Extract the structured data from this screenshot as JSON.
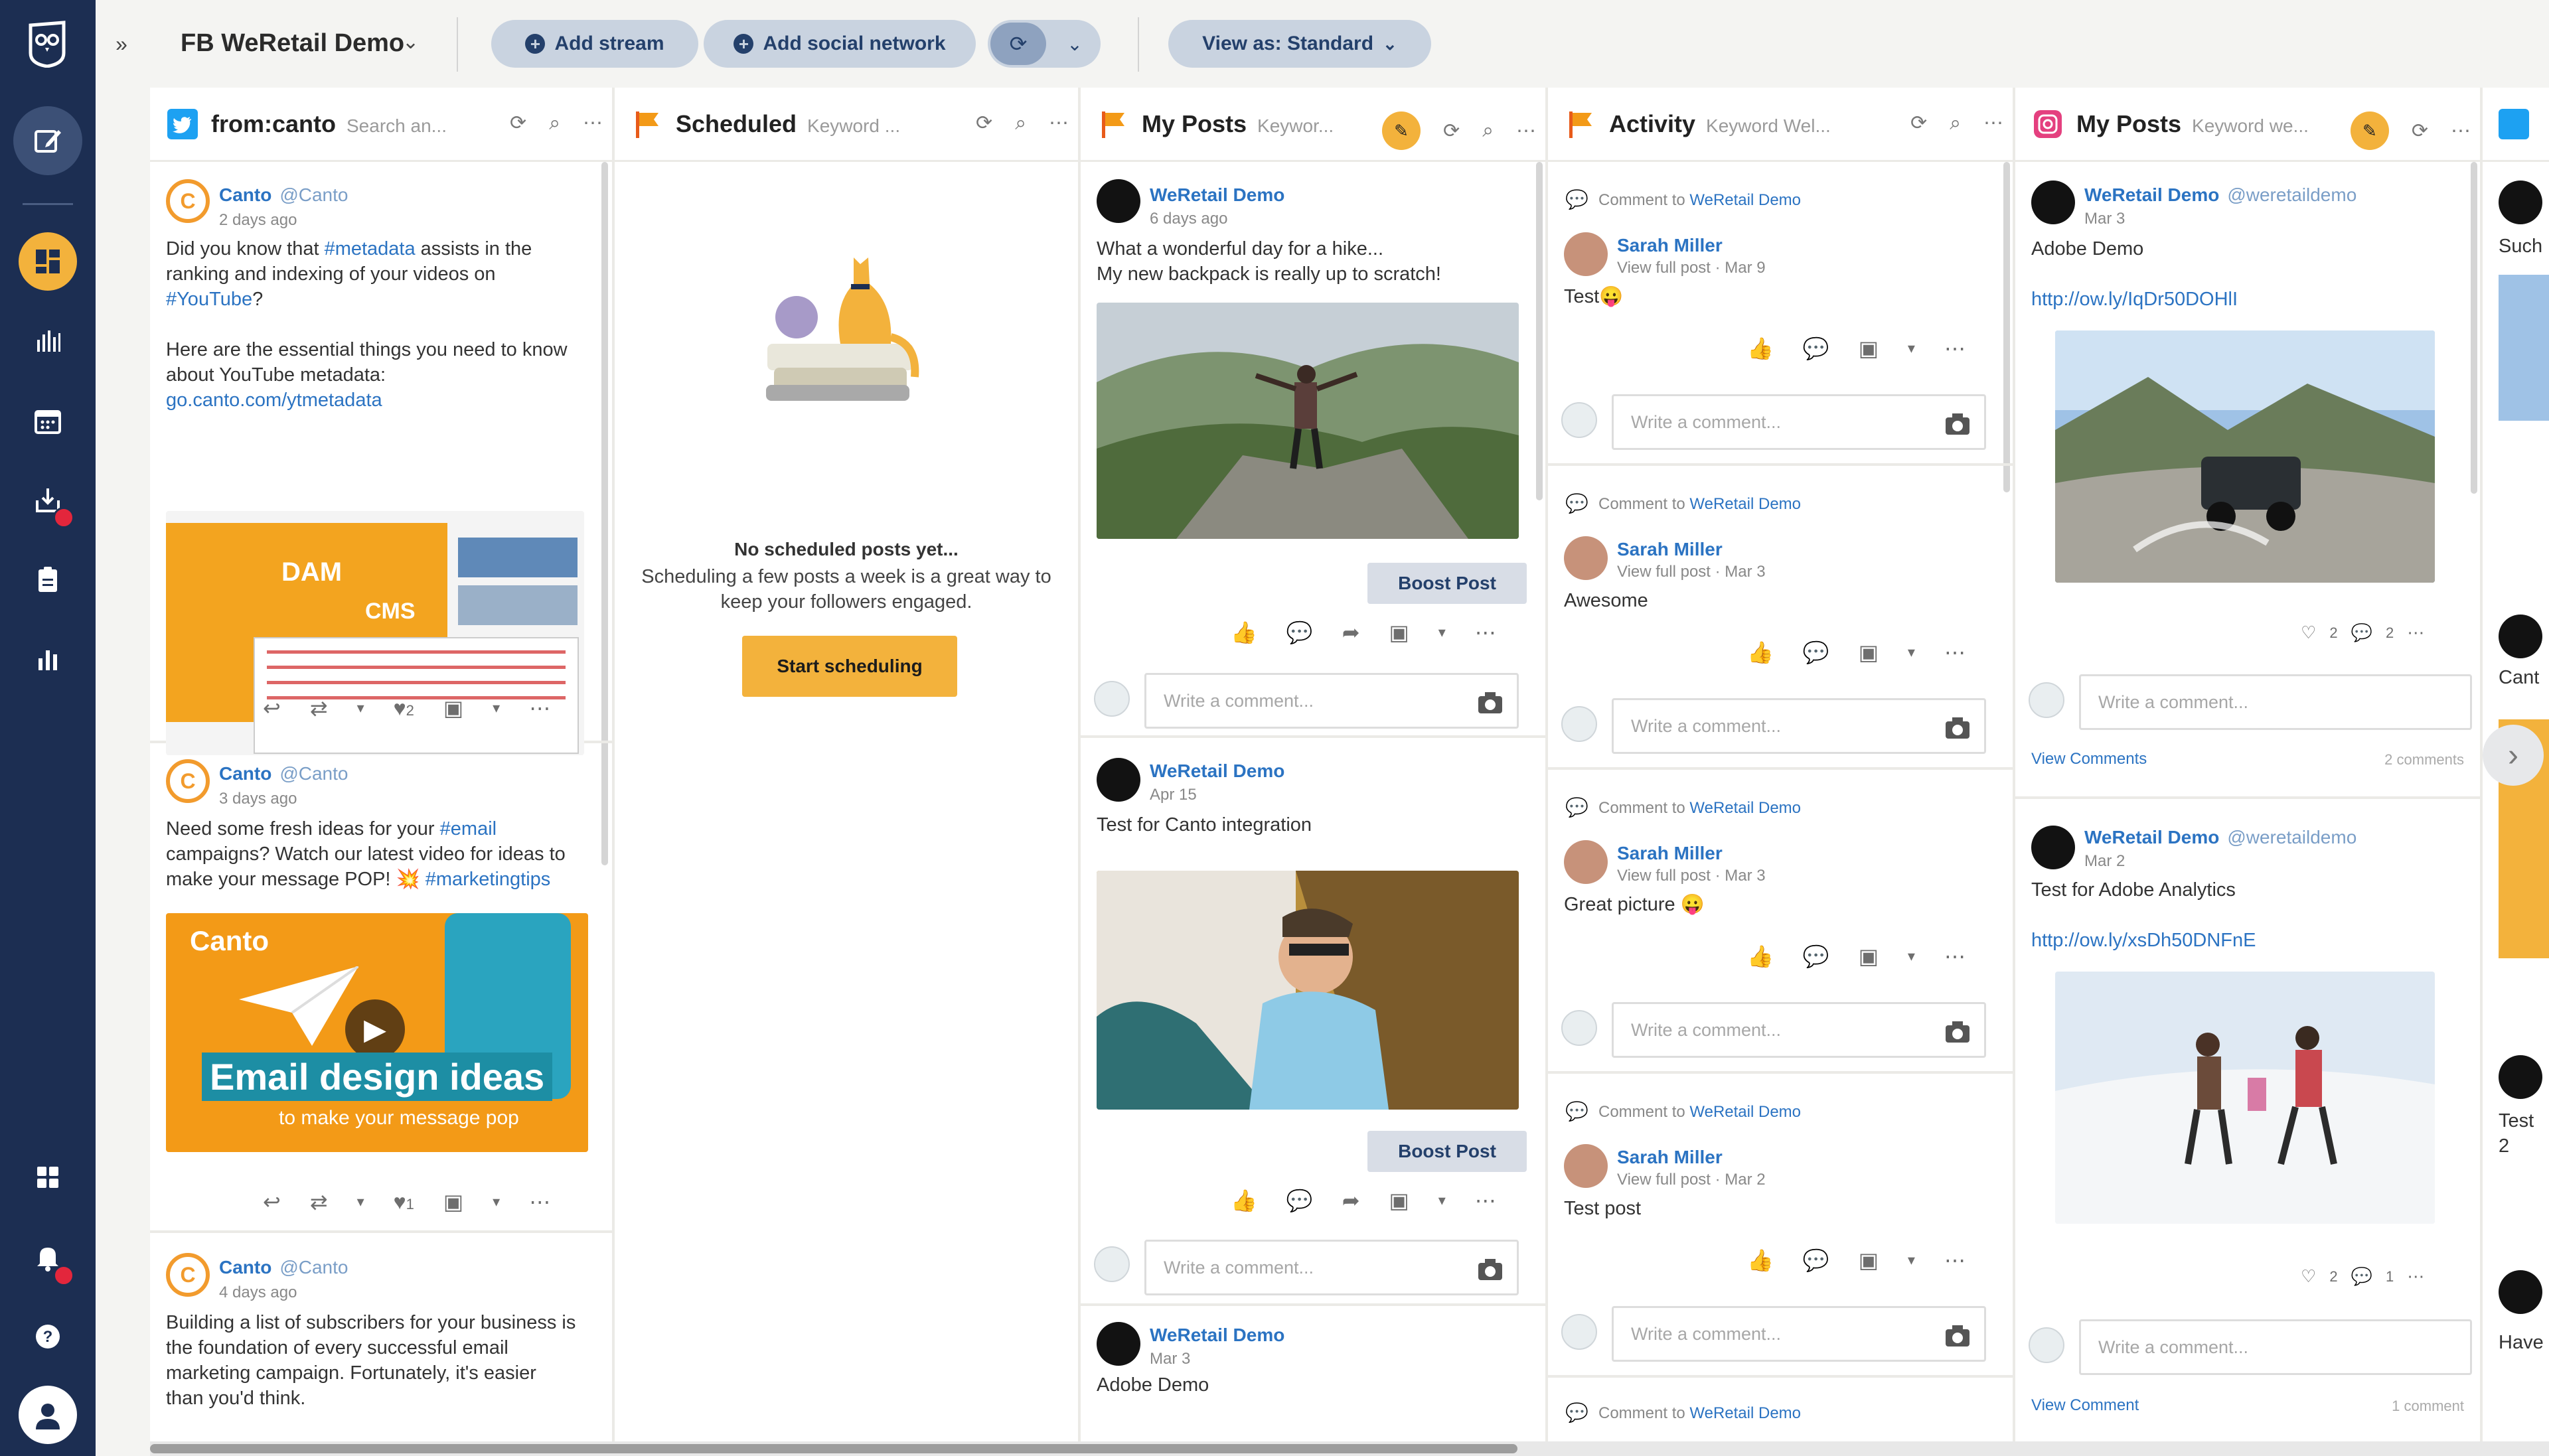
{
  "topbar": {
    "title": "FB WeRetail Demo",
    "add_stream": "Add stream",
    "add_social_network": "Add social network",
    "view_as": "View as: Standard"
  },
  "colors": {
    "nav": "#1c2e52",
    "accent": "#f3b23c",
    "link": "#2b73c2",
    "twitter": "#1da1f2",
    "instagram": "#e4407f"
  },
  "streams": {
    "s1": {
      "title": "from:canto",
      "subtitle": "Search an...",
      "posts": [
        {
          "name": "Canto",
          "handle": "@Canto",
          "time": "2 days ago",
          "text1_a": "Did you know that ",
          "text1_tag": "#metadata",
          "text1_b": " assists in the ranking and indexing of your videos on ",
          "text1_tag2": "#YouTube",
          "text1_c": "?",
          "text2": "Here are the essential things you need to know about YouTube metadata:",
          "link": "go.canto.com/ytmetadata",
          "img_label1": "DAM",
          "img_label2": "CMS",
          "likes": "2"
        },
        {
          "name": "Canto",
          "handle": "@Canto",
          "time": "3 days ago",
          "text_a": "Need some fresh ideas for your ",
          "text_tag": "#email",
          "text_b": " campaigns? Watch our latest video for ideas to make your message POP! 💥 ",
          "text_tag2": "#marketingtips",
          "img_brand": "Canto",
          "img_title": "Email design ideas",
          "img_sub": "to make your message pop",
          "likes": "1"
        },
        {
          "name": "Canto",
          "handle": "@Canto",
          "time": "4 days ago",
          "text": "Building a list of subscribers for your business is the foundation of every successful email marketing campaign. Fortunately, it's easier than you'd think."
        }
      ]
    },
    "s2": {
      "title": "Scheduled",
      "subtitle": "Keyword ...",
      "empty_title": "No scheduled posts yet...",
      "empty_sub": "Scheduling a few posts a week is a great way to keep your followers engaged.",
      "button": "Start scheduling"
    },
    "s3": {
      "title": "My Posts",
      "subtitle": "Keywor...",
      "boost": "Boost Post",
      "comment_placeholder": "Write a comment...",
      "posts": [
        {
          "name": "WeRetail Demo",
          "time": "6 days ago",
          "text": "What a wonderful day for a hike...\nMy new backpack is really up to scratch!"
        },
        {
          "name": "WeRetail Demo",
          "time": "Apr 15",
          "text": "Test for Canto integration"
        },
        {
          "name": "WeRetail Demo",
          "time": "Mar 3",
          "text": "Adobe Demo"
        }
      ]
    },
    "s4": {
      "title": "Activity",
      "subtitle": "Keyword Wel...",
      "comment_to": "Comment to",
      "page": "WeRetail Demo",
      "view_full": "View full post",
      "comment_placeholder": "Write a comment...",
      "items": [
        {
          "name": "Sarah Miller",
          "date": "Mar 9",
          "text": "Test😛"
        },
        {
          "name": "Sarah Miller",
          "date": "Mar 3",
          "text": "Awesome"
        },
        {
          "name": "Sarah Miller",
          "date": "Mar 3",
          "text": "Great picture 😛"
        },
        {
          "name": "Sarah Miller",
          "date": "Mar 2",
          "text": "Test post"
        }
      ]
    },
    "s5": {
      "title": "My Posts",
      "subtitle": "Keyword we...",
      "comment_placeholder": "Write a comment...",
      "posts": [
        {
          "name": "WeRetail Demo",
          "handle": "@weretaildemo",
          "time": "Mar 3",
          "text": "Adobe Demo",
          "link": "http://ow.ly/IqDr50DOHlI",
          "likes": "2",
          "comments": "2",
          "view": "View Comments",
          "count": "2 comments"
        },
        {
          "name": "WeRetail Demo",
          "handle": "@weretaildemo",
          "time": "Mar 2",
          "text": "Test for Adobe Analytics",
          "link": "http://ow.ly/xsDh50DNFnE",
          "likes": "2",
          "comments": "1",
          "view": "View Comment",
          "count": "1 comment"
        }
      ]
    },
    "s6": {
      "peek1": "Such",
      "peek2": "Cant",
      "peek3": "Test 2",
      "peek4": "Have"
    }
  }
}
